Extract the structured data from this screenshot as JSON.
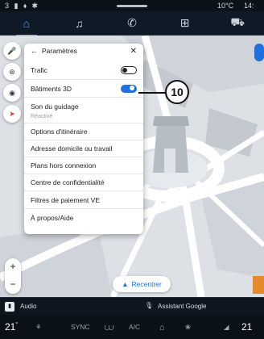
{
  "statusbar": {
    "indicators": "3 ▮ ⬧ ✱",
    "temperature": "10°C",
    "time": "14:"
  },
  "topnav": {
    "tabs": [
      {
        "name": "home",
        "glyph": "⌂",
        "active": true
      },
      {
        "name": "media",
        "glyph": "♫"
      },
      {
        "name": "phone",
        "glyph": "✆"
      },
      {
        "name": "apps",
        "glyph": "⊞"
      },
      {
        "name": "vehicle",
        "glyph": "⛟"
      }
    ]
  },
  "panel": {
    "back_glyph": "←",
    "title": "Paramètres",
    "close_glyph": "✕",
    "items": [
      {
        "label": "Trafic",
        "toggle": false
      },
      {
        "label": "Bâtiments 3D",
        "toggle": true
      },
      {
        "label": "Son du guidage",
        "sub": "Réactivé"
      },
      {
        "label": "Options d'itinéraire"
      },
      {
        "label": "Adresse domicile ou travail"
      },
      {
        "label": "Plans hors connexion"
      },
      {
        "label": "Centre de confidentialité"
      },
      {
        "label": "Filtres de paiement VE"
      },
      {
        "label": "À propos/Aide"
      }
    ]
  },
  "callout": {
    "number": "10"
  },
  "map": {
    "recenter_label": "Recentrer",
    "zoom_in": "+",
    "zoom_out": "−",
    "controls": [
      "mic-icon",
      "layers-icon",
      "sound-icon",
      "compass-icon"
    ],
    "colors": {
      "road": "#ffffff",
      "land": "#dfe3e8",
      "building": "#c8cdd3",
      "accent": "#1f6fe0"
    }
  },
  "audiobar": {
    "label": "Audio",
    "assistant": "Assistant Google"
  },
  "climate": {
    "left_temp": "21",
    "left_unit": "°",
    "sync": "SYNC",
    "ac": "A/C",
    "right_temp": "21"
  }
}
